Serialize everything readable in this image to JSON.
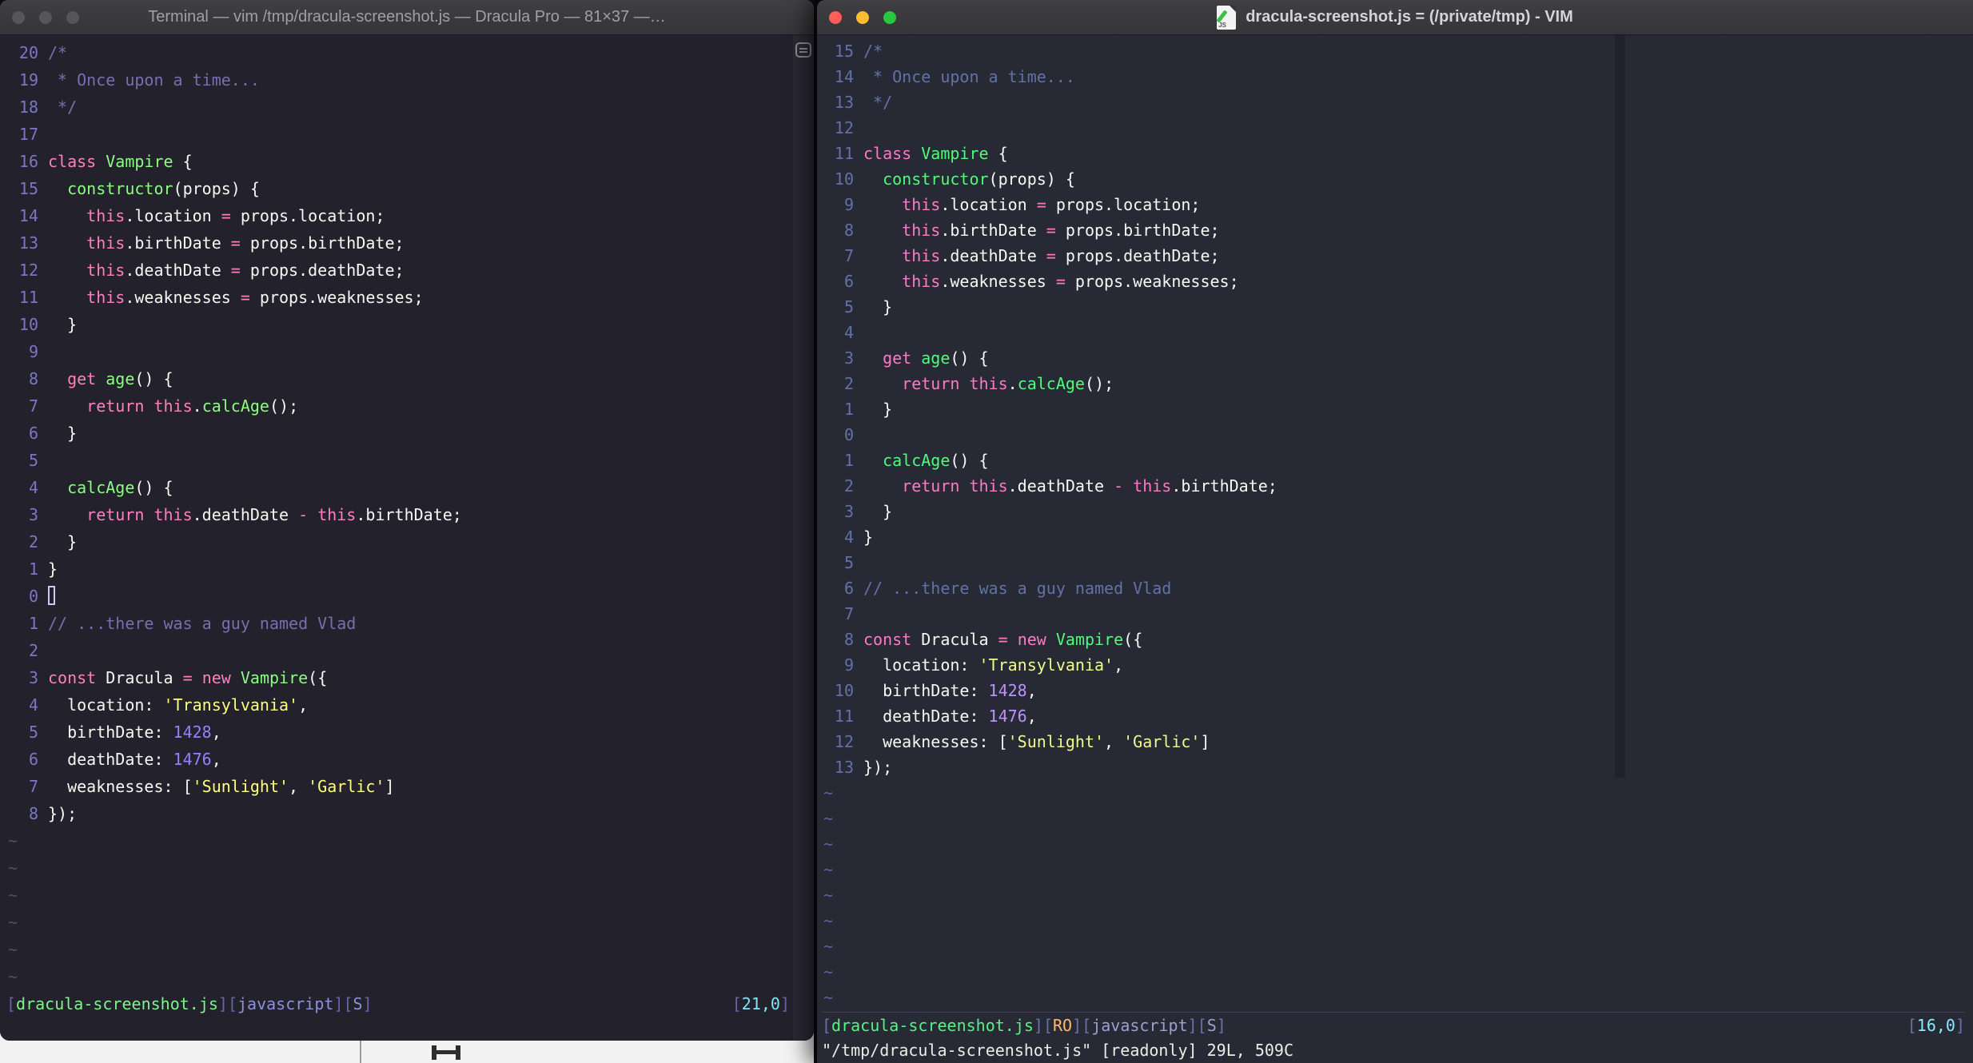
{
  "left_window": {
    "title": "Terminal — vim /tmp/dracula-screenshot.js — Dracula Pro — 81×37 —…",
    "traffic_lights": {
      "close": "#55555a",
      "minimize": "#55555a",
      "zoom": "#55555a"
    },
    "theme": {
      "bg": "#22212C",
      "fg": "#F8F8F2",
      "ln": "#7C76C4",
      "com": "#7670AE",
      "kw": "#FF80BF",
      "fn": "#8AFF80",
      "str": "#FFFF80",
      "num": "#9580FF",
      "tilde": "#504A6B",
      "cursor": "#CFC9F4",
      "sbr": "#6A63A8",
      "sfile": "#7EF58B",
      "sft": "#8C92DB",
      "scoord": "#86E3F5",
      "cmd": "#F8F8F2"
    },
    "tilde_char": "~",
    "tilde_rows": 6,
    "status": {
      "left": [
        [
          "sbr",
          "["
        ],
        [
          "sfile",
          "dracula-screenshot.js"
        ],
        [
          "sbr",
          "]["
        ],
        [
          "sft",
          "javascript"
        ],
        [
          "sbr",
          "]["
        ],
        [
          "sft",
          "S"
        ],
        [
          "sbr",
          "]"
        ]
      ],
      "right": [
        [
          "sbr",
          "["
        ],
        [
          "scoord",
          "21,0"
        ],
        [
          "sbr",
          "]"
        ]
      ]
    },
    "lines": [
      {
        "n": "20",
        "s": [
          [
            "com",
            "/*"
          ]
        ]
      },
      {
        "n": "19",
        "s": [
          [
            "com",
            " * Once upon a time..."
          ]
        ]
      },
      {
        "n": "18",
        "s": [
          [
            "com",
            " */"
          ]
        ]
      },
      {
        "n": "17",
        "s": []
      },
      {
        "n": "16",
        "s": [
          [
            "kw",
            "class"
          ],
          [
            "pl",
            " "
          ],
          [
            "fn",
            "Vampire"
          ],
          [
            "pl",
            " {"
          ]
        ]
      },
      {
        "n": "15",
        "s": [
          [
            "pl",
            "  "
          ],
          [
            "fn",
            "constructor"
          ],
          [
            "pl",
            "(props) {"
          ]
        ]
      },
      {
        "n": "14",
        "s": [
          [
            "pl",
            "    "
          ],
          [
            "kw",
            "this"
          ],
          [
            "pl",
            ".location "
          ],
          [
            "kw",
            "="
          ],
          [
            "pl",
            " props.location;"
          ]
        ]
      },
      {
        "n": "13",
        "s": [
          [
            "pl",
            "    "
          ],
          [
            "kw",
            "this"
          ],
          [
            "pl",
            ".birthDate "
          ],
          [
            "kw",
            "="
          ],
          [
            "pl",
            " props.birthDate;"
          ]
        ]
      },
      {
        "n": "12",
        "s": [
          [
            "pl",
            "    "
          ],
          [
            "kw",
            "this"
          ],
          [
            "pl",
            ".deathDate "
          ],
          [
            "kw",
            "="
          ],
          [
            "pl",
            " props.deathDate;"
          ]
        ]
      },
      {
        "n": "11",
        "s": [
          [
            "pl",
            "    "
          ],
          [
            "kw",
            "this"
          ],
          [
            "pl",
            ".weaknesses "
          ],
          [
            "kw",
            "="
          ],
          [
            "pl",
            " props.weaknesses;"
          ]
        ]
      },
      {
        "n": "10",
        "s": [
          [
            "pl",
            "  }"
          ]
        ]
      },
      {
        "n": "9",
        "s": []
      },
      {
        "n": "8",
        "s": [
          [
            "pl",
            "  "
          ],
          [
            "kw",
            "get"
          ],
          [
            "pl",
            " "
          ],
          [
            "fn",
            "age"
          ],
          [
            "pl",
            "() {"
          ]
        ]
      },
      {
        "n": "7",
        "s": [
          [
            "pl",
            "    "
          ],
          [
            "kw",
            "return"
          ],
          [
            "pl",
            " "
          ],
          [
            "kw",
            "this"
          ],
          [
            "pl",
            "."
          ],
          [
            "fn",
            "calcAge"
          ],
          [
            "pl",
            "();"
          ]
        ]
      },
      {
        "n": "6",
        "s": [
          [
            "pl",
            "  }"
          ]
        ]
      },
      {
        "n": "5",
        "s": []
      },
      {
        "n": "4",
        "s": [
          [
            "pl",
            "  "
          ],
          [
            "fn",
            "calcAge"
          ],
          [
            "pl",
            "() {"
          ]
        ]
      },
      {
        "n": "3",
        "s": [
          [
            "pl",
            "    "
          ],
          [
            "kw",
            "return"
          ],
          [
            "pl",
            " "
          ],
          [
            "kw",
            "this"
          ],
          [
            "pl",
            ".deathDate "
          ],
          [
            "kw",
            "-"
          ],
          [
            "pl",
            " "
          ],
          [
            "kw",
            "this"
          ],
          [
            "pl",
            ".birthDate;"
          ]
        ]
      },
      {
        "n": "2",
        "s": [
          [
            "pl",
            "  }"
          ]
        ]
      },
      {
        "n": "1",
        "s": [
          [
            "pl",
            "}"
          ]
        ]
      },
      {
        "n": "0",
        "s": [],
        "cursor": "hollow"
      },
      {
        "n": "1",
        "s": [
          [
            "com",
            "// ...there was a guy named Vlad"
          ]
        ]
      },
      {
        "n": "2",
        "s": []
      },
      {
        "n": "3",
        "s": [
          [
            "kw",
            "const"
          ],
          [
            "pl",
            " Dracula "
          ],
          [
            "kw",
            "="
          ],
          [
            "pl",
            " "
          ],
          [
            "kw",
            "new"
          ],
          [
            "pl",
            " "
          ],
          [
            "fn",
            "Vampire"
          ],
          [
            "pl",
            "({"
          ]
        ]
      },
      {
        "n": "4",
        "s": [
          [
            "pl",
            "  location: "
          ],
          [
            "str",
            "'Transylvania'"
          ],
          [
            "pl",
            ","
          ]
        ]
      },
      {
        "n": "5",
        "s": [
          [
            "pl",
            "  birthDate: "
          ],
          [
            "num",
            "1428"
          ],
          [
            "pl",
            ","
          ]
        ]
      },
      {
        "n": "6",
        "s": [
          [
            "pl",
            "  deathDate: "
          ],
          [
            "num",
            "1476"
          ],
          [
            "pl",
            ","
          ]
        ]
      },
      {
        "n": "7",
        "s": [
          [
            "pl",
            "  weaknesses: ["
          ],
          [
            "str",
            "'Sunlight'"
          ],
          [
            "pl",
            ", "
          ],
          [
            "str",
            "'Garlic'"
          ],
          [
            "pl",
            "]"
          ]
        ]
      },
      {
        "n": "8",
        "s": [
          [
            "pl",
            "});"
          ]
        ]
      }
    ]
  },
  "right_window": {
    "title": "dracula-screenshot.js = (/private/tmp) - VIM",
    "icon_label": "JS",
    "traffic_lights": {
      "close": "#FF5F57",
      "minimize": "#FEBC2E",
      "zoom": "#28C840"
    },
    "command_line": "\"/tmp/dracula-screenshot.js\" [readonly] 29L, 509C",
    "theme": {
      "bg": "#272935",
      "fg": "#F8F8F2",
      "ln": "#6272A4",
      "com": "#6272A4",
      "kw": "#FF79C6",
      "fn": "#50FA7B",
      "str": "#F1FA8C",
      "num": "#BD93F9",
      "tilde": "#596595",
      "cursor": "#F8F8F2",
      "sbr": "#6672A8",
      "sfile": "#57F284",
      "sro": "#FFB86C",
      "sft": "#97A3CE",
      "scoord": "#8BE9FD",
      "cmd": "#EDEDE4"
    },
    "tilde_char": "~",
    "tilde_rows": 9,
    "status": {
      "left": [
        [
          "sbr",
          "["
        ],
        [
          "sfile",
          "dracula-screenshot.js"
        ],
        [
          "sbr",
          "]["
        ],
        [
          "sro",
          "RO"
        ],
        [
          "sbr",
          "]["
        ],
        [
          "sft",
          "javascript"
        ],
        [
          "sbr",
          "]["
        ],
        [
          "sft",
          "S"
        ],
        [
          "sbr",
          "]"
        ]
      ],
      "right": [
        [
          "sbr",
          "["
        ],
        [
          "scoord",
          "16,0"
        ],
        [
          "sbr",
          "]"
        ]
      ]
    },
    "lines": [
      {
        "n": "15",
        "s": [
          [
            "com",
            "/*"
          ]
        ]
      },
      {
        "n": "14",
        "s": [
          [
            "com",
            " * Once upon a time..."
          ]
        ]
      },
      {
        "n": "13",
        "s": [
          [
            "com",
            " */"
          ]
        ]
      },
      {
        "n": "12",
        "s": []
      },
      {
        "n": "11",
        "s": [
          [
            "kw",
            "class"
          ],
          [
            "pl",
            " "
          ],
          [
            "fn",
            "Vampire"
          ],
          [
            "pl",
            " {"
          ]
        ]
      },
      {
        "n": "10",
        "s": [
          [
            "pl",
            "  "
          ],
          [
            "fn",
            "constructor"
          ],
          [
            "pl",
            "(props) {"
          ]
        ]
      },
      {
        "n": "9",
        "s": [
          [
            "pl",
            "    "
          ],
          [
            "kw",
            "this"
          ],
          [
            "pl",
            ".location "
          ],
          [
            "kw",
            "="
          ],
          [
            "pl",
            " props.location;"
          ]
        ]
      },
      {
        "n": "8",
        "s": [
          [
            "pl",
            "    "
          ],
          [
            "kw",
            "this"
          ],
          [
            "pl",
            ".birthDate "
          ],
          [
            "kw",
            "="
          ],
          [
            "pl",
            " props.birthDate;"
          ]
        ]
      },
      {
        "n": "7",
        "s": [
          [
            "pl",
            "    "
          ],
          [
            "kw",
            "this"
          ],
          [
            "pl",
            ".deathDate "
          ],
          [
            "kw",
            "="
          ],
          [
            "pl",
            " props.deathDate;"
          ]
        ]
      },
      {
        "n": "6",
        "s": [
          [
            "pl",
            "    "
          ],
          [
            "kw",
            "this"
          ],
          [
            "pl",
            ".weaknesses "
          ],
          [
            "kw",
            "="
          ],
          [
            "pl",
            " props.weaknesses;"
          ]
        ]
      },
      {
        "n": "5",
        "s": [
          [
            "pl",
            "  }"
          ]
        ]
      },
      {
        "n": "4",
        "s": []
      },
      {
        "n": "3",
        "s": [
          [
            "pl",
            "  "
          ],
          [
            "kw",
            "get"
          ],
          [
            "pl",
            " "
          ],
          [
            "fn",
            "age"
          ],
          [
            "pl",
            "() {"
          ]
        ]
      },
      {
        "n": "2",
        "s": [
          [
            "pl",
            "    "
          ],
          [
            "kw",
            "return"
          ],
          [
            "pl",
            " "
          ],
          [
            "kw",
            "this"
          ],
          [
            "pl",
            "."
          ],
          [
            "fn",
            "calcAge"
          ],
          [
            "pl",
            "();"
          ]
        ]
      },
      {
        "n": "1",
        "s": [
          [
            "pl",
            "  }"
          ]
        ]
      },
      {
        "n": "0",
        "s": []
      },
      {
        "n": "1",
        "s": [
          [
            "pl",
            "  "
          ],
          [
            "fn",
            "calcAge"
          ],
          [
            "pl",
            "() {"
          ]
        ]
      },
      {
        "n": "2",
        "s": [
          [
            "pl",
            "    "
          ],
          [
            "kw",
            "return"
          ],
          [
            "pl",
            " "
          ],
          [
            "kw",
            "this"
          ],
          [
            "pl",
            ".deathDate "
          ],
          [
            "kw",
            "-"
          ],
          [
            "pl",
            " "
          ],
          [
            "kw",
            "this"
          ],
          [
            "pl",
            ".birthDate;"
          ]
        ]
      },
      {
        "n": "3",
        "s": [
          [
            "pl",
            "  }"
          ]
        ]
      },
      {
        "n": "4",
        "s": [
          [
            "pl",
            "}"
          ]
        ]
      },
      {
        "n": "5",
        "s": []
      },
      {
        "n": "6",
        "s": [
          [
            "com",
            "// ...there was a guy named Vlad"
          ]
        ]
      },
      {
        "n": "7",
        "s": []
      },
      {
        "n": "8",
        "s": [
          [
            "kw",
            "const"
          ],
          [
            "pl",
            " Dracula "
          ],
          [
            "kw",
            "="
          ],
          [
            "pl",
            " "
          ],
          [
            "kw",
            "new"
          ],
          [
            "pl",
            " "
          ],
          [
            "fn",
            "Vampire"
          ],
          [
            "pl",
            "({"
          ]
        ]
      },
      {
        "n": "9",
        "s": [
          [
            "pl",
            "  location: "
          ],
          [
            "str",
            "'Transylvania'"
          ],
          [
            "pl",
            ","
          ]
        ]
      },
      {
        "n": "10",
        "s": [
          [
            "pl",
            "  birthDate: "
          ],
          [
            "num",
            "1428"
          ],
          [
            "pl",
            ","
          ]
        ]
      },
      {
        "n": "11",
        "s": [
          [
            "pl",
            "  deathDate: "
          ],
          [
            "num",
            "1476"
          ],
          [
            "pl",
            ","
          ]
        ]
      },
      {
        "n": "12",
        "s": [
          [
            "pl",
            "  weaknesses: ["
          ],
          [
            "str",
            "'Sunlight'"
          ],
          [
            "pl",
            ", "
          ],
          [
            "str",
            "'Garlic'"
          ],
          [
            "pl",
            "]"
          ]
        ]
      },
      {
        "n": "13",
        "s": [
          [
            "pl",
            "});"
          ]
        ]
      }
    ]
  }
}
